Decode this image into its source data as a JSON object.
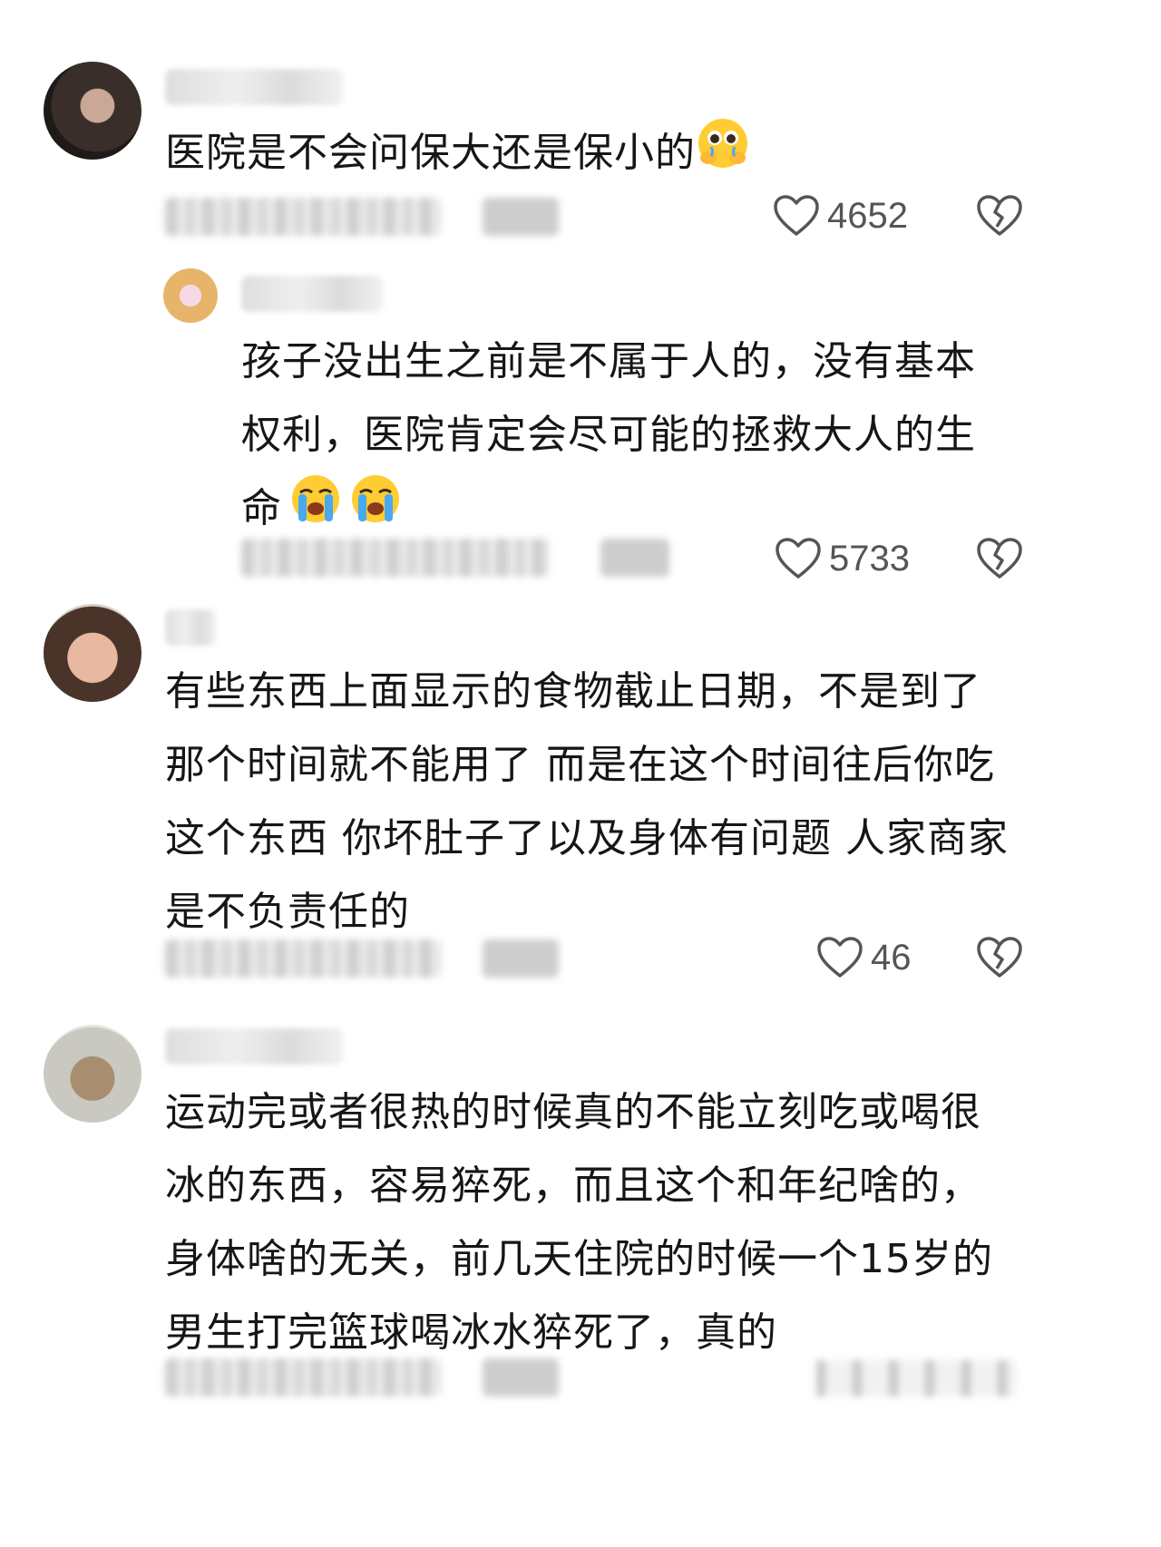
{
  "comments": [
    {
      "text": "医院是不会问保大还是保小的",
      "emoji": "pleading-face-hands-over-mouth",
      "likes": "4652"
    },
    {
      "text": "孩子没出生之前是不属于人的，没有基本\n权利，医院肯定会尽可能的拯救大人的生\n命",
      "emoji": "loudly-crying-face",
      "likes": "5733"
    },
    {
      "text": "有些东西上面显示的食物截止日期，不是到了\n那个时间就不能用了 而是在这个时间往后你吃\n这个东西 你坏肚子了以及身体有问题 人家商家\n是不负责任的",
      "likes": "46"
    },
    {
      "text": "运动完或者很热的时候真的不能立刻吃或喝很\n冰的东西，容易猝死，而且这个和年纪啥的，\n身体啥的无关，前几天住院的时候一个15岁的\n男生打完篮球喝冰水猝死了，真的"
    }
  ],
  "colors": {
    "text": "#161616",
    "icon": "#555555",
    "meta_blur": "#d0d0d0"
  }
}
